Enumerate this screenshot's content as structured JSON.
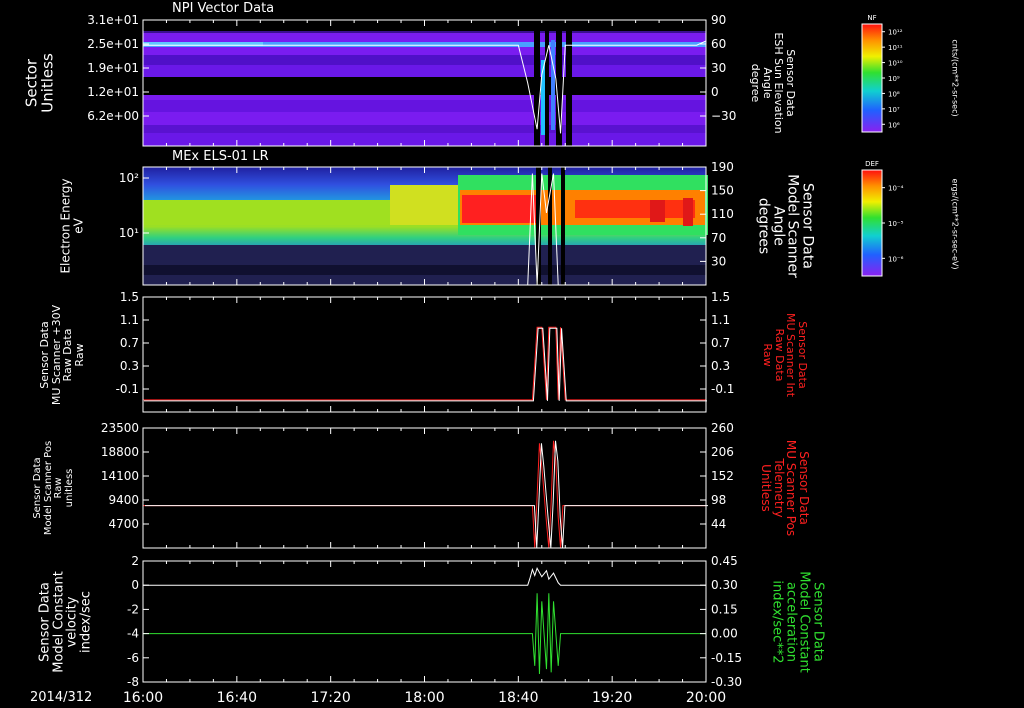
{
  "date_label": "2014/312",
  "time_ticks": [
    "16:00",
    "16:40",
    "17:20",
    "18:00",
    "18:40",
    "19:20",
    "20:00"
  ],
  "panels": [
    {
      "title": "NPI Vector Data",
      "left_label": [
        "Sector",
        "Unitless"
      ],
      "left_ticks": [
        "3.1e+01",
        "2.5e+01",
        "1.9e+01",
        "1.2e+01",
        "6.2e+00"
      ],
      "right_label": [
        "Sensor Data",
        "ESH Sun Elevation",
        "Angle",
        "degree"
      ],
      "right_ticks": [
        "90",
        "60",
        "30",
        "0",
        "−30"
      ],
      "colorbar": {
        "label": "NF",
        "unit": "cnts/(cm**2-sr-sec)",
        "ticks": [
          "10¹²",
          "10¹¹",
          "10¹⁰",
          "10⁹",
          "10⁸",
          "10⁷",
          "10⁶"
        ]
      }
    },
    {
      "title": "MEx ELS-01 LR",
      "left_label": [
        "Electron Energy",
        "eV"
      ],
      "left_ticks": [
        "10²",
        "10¹"
      ],
      "right_label": [
        "Sensor Data",
        "Model Scanner",
        "Angle",
        "degrees"
      ],
      "right_ticks": [
        "190",
        "150",
        "110",
        "70",
        "30"
      ],
      "colorbar": {
        "label": "DEF",
        "unit": "ergs/(cm**2-sr-sec-eV)",
        "ticks": [
          "10⁻⁴",
          "10⁻⁵",
          "10⁻⁶"
        ]
      }
    },
    {
      "title": "",
      "left_label": [
        "Sensor Data",
        "MU Scanner +30V",
        "Raw Data",
        "Raw"
      ],
      "left_ticks": [
        "1.5",
        "1.1",
        "0.7",
        "0.3",
        "-0.1"
      ],
      "right_label": [
        "Sensor Data",
        "MU Scanner Int",
        "Raw Data",
        "Raw"
      ],
      "right_ticks": [
        "1.5",
        "1.1",
        "0.7",
        "0.3",
        "-0.1"
      ]
    },
    {
      "title": "",
      "left_label": [
        "Sensor Data",
        "Model Scanner Pos",
        "Raw",
        "unitless"
      ],
      "left_ticks": [
        "23500",
        "18800",
        "14100",
        "9400",
        "4700"
      ],
      "right_label": [
        "Sensor Data",
        "MU Scanner Pos",
        "Telemetry",
        "Unitless"
      ],
      "right_ticks": [
        "260",
        "206",
        "152",
        "98",
        "44"
      ]
    },
    {
      "title": "",
      "left_label": [
        "Sensor Data",
        "Model Constant",
        "velocity",
        "index/sec"
      ],
      "left_ticks": [
        "2",
        "0",
        "-2",
        "-4",
        "-6",
        "-8"
      ],
      "right_label": [
        "Sensor Data",
        "Model Constant",
        "acceleration",
        "index/sec**2"
      ],
      "right_ticks": [
        "0.45",
        "0.30",
        "0.15",
        "0.00",
        "-0.15",
        "-0.30"
      ]
    }
  ],
  "colors": {
    "background": "#000000",
    "axis": "#ffffff",
    "raw_red": "#ff2020",
    "accel_green": "#30e030",
    "spectro_purple": "#7a1cf0"
  },
  "chart_data": [
    {
      "type": "heatmap",
      "title": "NPI Vector Data",
      "x_range": [
        "16:00",
        "20:00"
      ],
      "ylabel": "Sector Unitless",
      "ylim": [
        0,
        31
      ],
      "y2label": "Sensor Data ESH Sun Elevation Angle degree",
      "y2lim": [
        -60,
        90
      ],
      "overlay_series": [
        {
          "x": [
            "16:00",
            "18:40",
            "18:44",
            "18:48",
            "18:50",
            "18:53",
            "18:56",
            "18:58",
            "19:00",
            "19:56",
            "20:00"
          ],
          "y": [
            60,
            60,
            15,
            -40,
            25,
            60,
            20,
            -45,
            60,
            60,
            65
          ]
        }
      ],
      "colorbar": {
        "label": "NF",
        "unit": "cnts/(cm**2-sr-sec)",
        "range": [
          1000000.0,
          1000000000000.0
        ],
        "scale": "log"
      }
    },
    {
      "type": "heatmap",
      "title": "MEx ELS-01 LR",
      "x_range": [
        "16:00",
        "20:00"
      ],
      "ylabel": "Electron Energy eV",
      "ylim": [
        1,
        190
      ],
      "yscale": "log",
      "y2label": "Sensor Data Model Scanner Angle degrees",
      "y2lim": [
        10,
        190
      ],
      "overlay_series": [
        {
          "x": [
            "16:00",
            "18:44",
            "18:46",
            "18:48",
            "18:50",
            "18:52",
            "18:55",
            "18:57",
            "18:58",
            "20:00"
          ],
          "y": [
            10,
            10,
            180,
            10,
            180,
            120,
            180,
            10,
            10,
            10
          ]
        }
      ],
      "colorbar": {
        "label": "DEF",
        "unit": "ergs/(cm**2-sr-sec-eV)",
        "range": [
          1e-06,
          0.0001
        ],
        "scale": "log"
      }
    },
    {
      "type": "line",
      "ylabel": "Sensor Data MU Scanner +30V Raw Data Raw",
      "ylim": [
        -0.4,
        1.5
      ],
      "y2label": "Sensor Data MU Scanner Int Raw Data Raw",
      "series": [
        {
          "x": [
            "16:00",
            "18:46",
            "18:48",
            "18:50",
            "18:52",
            "18:53",
            "18:54",
            "18:56",
            "18:57",
            "18:58",
            "19:00",
            "20:00"
          ],
          "y": [
            -0.2,
            -0.2,
            1.0,
            1.0,
            -0.2,
            1.0,
            1.0,
            1.0,
            -0.2,
            1.0,
            -0.2,
            -0.2
          ]
        }
      ]
    },
    {
      "type": "line",
      "ylabel": "Sensor Data Model Scanner Pos Raw unitless",
      "ylim": [
        0,
        23500
      ],
      "y2label": "Sensor Data MU Scanner Pos Telemetry Unitless",
      "y2lim": [
        0,
        260
      ],
      "series": [
        {
          "x": [
            "16:00",
            "18:46",
            "18:47",
            "18:48",
            "18:49",
            "18:50",
            "18:52",
            "18:53",
            "18:54",
            "18:55",
            "18:56",
            "18:57",
            "18:58",
            "18:59",
            "20:00"
          ],
          "y": [
            8300,
            8300,
            0,
            10000,
            20500,
            16000,
            5000,
            0,
            9000,
            21000,
            17000,
            6000,
            0,
            8300,
            8300
          ]
        }
      ]
    },
    {
      "type": "line",
      "ylabel": "Sensor Data Model Constant velocity index/sec",
      "ylim": [
        -8,
        2
      ],
      "y2label": "Sensor Data Model Constant acceleration index/sec**2",
      "y2lim": [
        -0.3,
        0.45
      ],
      "series": [
        {
          "x": [
            "16:00",
            "18:44",
            "18:45",
            "18:46",
            "18:47",
            "18:48",
            "18:50",
            "18:52",
            "18:53",
            "18:55",
            "18:57",
            "18:58",
            "20:00"
          ],
          "y": [
            0,
            0,
            0.6,
            1.3,
            0.8,
            1.4,
            0.7,
            1.2,
            0.5,
            1.0,
            0.2,
            0,
            0
          ]
        },
        {
          "x": [
            "16:00",
            "18:46",
            "18:47",
            "18:48",
            "18:49",
            "18:50",
            "18:52",
            "18:53",
            "18:54",
            "18:55",
            "18:57",
            "18:58",
            "20:00"
          ],
          "y": [
            0.0,
            0.0,
            -0.2,
            0.25,
            -0.25,
            0.2,
            -0.22,
            0.25,
            -0.24,
            0.2,
            -0.2,
            0.0,
            0.0
          ],
          "axis": "right"
        }
      ]
    }
  ]
}
